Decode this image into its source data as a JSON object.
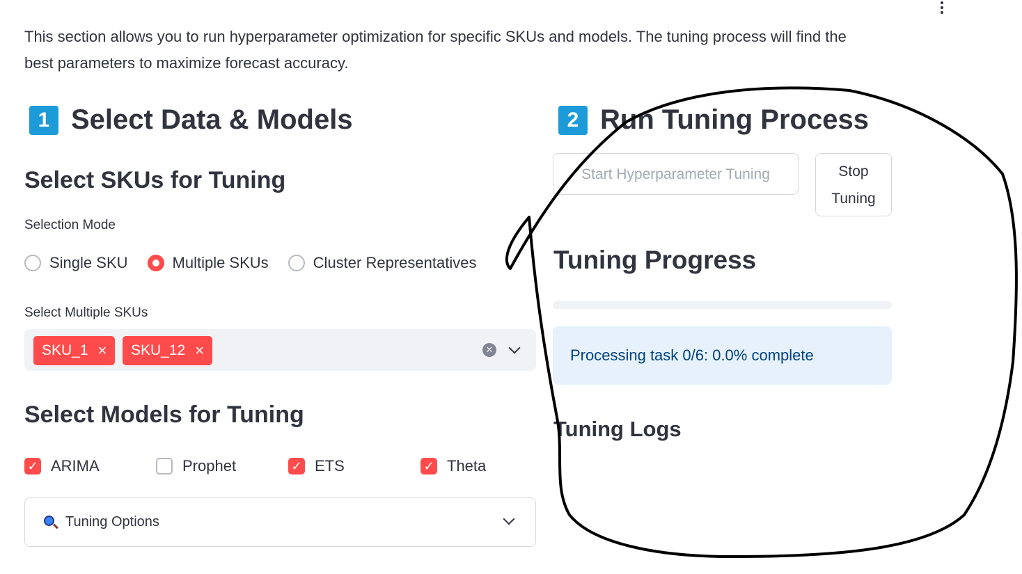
{
  "intro": {
    "line1": "This section allows you to run hyperparameter optimization for specific SKUs and models. The tuning process will find the",
    "line2": "best parameters to maximize forecast accuracy."
  },
  "section1": {
    "badge": "1",
    "title": "Select Data & Models",
    "badge_color": "#1c9bd8"
  },
  "skus": {
    "heading": "Select SKUs for Tuning",
    "mode_label": "Selection Mode",
    "modes": [
      {
        "label": "Single SKU",
        "selected": false
      },
      {
        "label": "Multiple SKUs",
        "selected": true
      },
      {
        "label": "Cluster Representatives",
        "selected": false
      }
    ],
    "multi_label": "Select Multiple SKUs",
    "selected": [
      "SKU_1",
      "SKU_12"
    ],
    "tag_remove_glyph": "×",
    "accent_color": "#ff4b4b"
  },
  "models": {
    "heading": "Select Models for Tuning",
    "items": [
      {
        "label": "ARIMA",
        "checked": true
      },
      {
        "label": "Prophet",
        "checked": false
      },
      {
        "label": "ETS",
        "checked": true
      },
      {
        "label": "Theta",
        "checked": true
      }
    ]
  },
  "options": {
    "label": "Tuning Options",
    "icon": "magnifier-icon"
  },
  "section2": {
    "badge": "2",
    "title": "Run Tuning Process"
  },
  "buttons": {
    "start": "Start Hyperparameter Tuning",
    "stop_line1": "Stop",
    "stop_line2": "Tuning"
  },
  "progress": {
    "heading": "Tuning Progress",
    "fraction": 0.0,
    "status": "Processing task 0/6: 0.0% complete"
  },
  "logs": {
    "heading": "Tuning Logs"
  }
}
